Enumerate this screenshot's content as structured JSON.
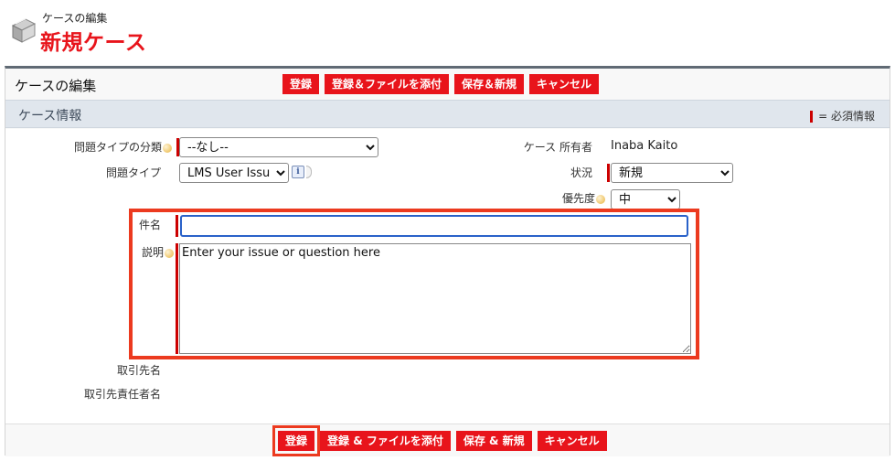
{
  "header": {
    "subtitle": "ケースの編集",
    "title": "新規ケース"
  },
  "edit_panel": {
    "title": "ケースの編集",
    "buttons": {
      "save": "登録",
      "save_attach": "登録＆ファイルを添付",
      "save_new": "保存＆新規",
      "cancel": "キャンセル"
    },
    "bottom_buttons": {
      "save": "登録",
      "save_attach": "登録 & ファイルを添付",
      "save_new": "保存 & 新規",
      "cancel": "キャンセル"
    }
  },
  "section": {
    "title": "ケース情報",
    "required_legend": "= 必須情報"
  },
  "fields": {
    "issue_category": {
      "label": "問題タイプの分類",
      "value": "--なし--"
    },
    "issue_type": {
      "label": "問題タイプ",
      "value": "LMS User Issue"
    },
    "case_owner": {
      "label": "ケース 所有者",
      "value": "Inaba Kaito"
    },
    "status": {
      "label": "状況",
      "value": "新規"
    },
    "priority": {
      "label": "優先度",
      "value": "中"
    },
    "subject": {
      "label": "件名",
      "value": ""
    },
    "description": {
      "label": "説明",
      "placeholder": "Enter your issue or question here"
    },
    "account_name": {
      "label": "取引先名"
    },
    "contact_name": {
      "label": "取引先責任者名"
    }
  },
  "colors": {
    "brand_red": "#e8141b",
    "highlight_outline": "#ec3a1f",
    "section_bar": "#e0e6ed"
  },
  "icons": {
    "page_icon": "case-briefcase-icon",
    "info_icon": "info-icon",
    "help_icon": "help-bubble-icon"
  }
}
